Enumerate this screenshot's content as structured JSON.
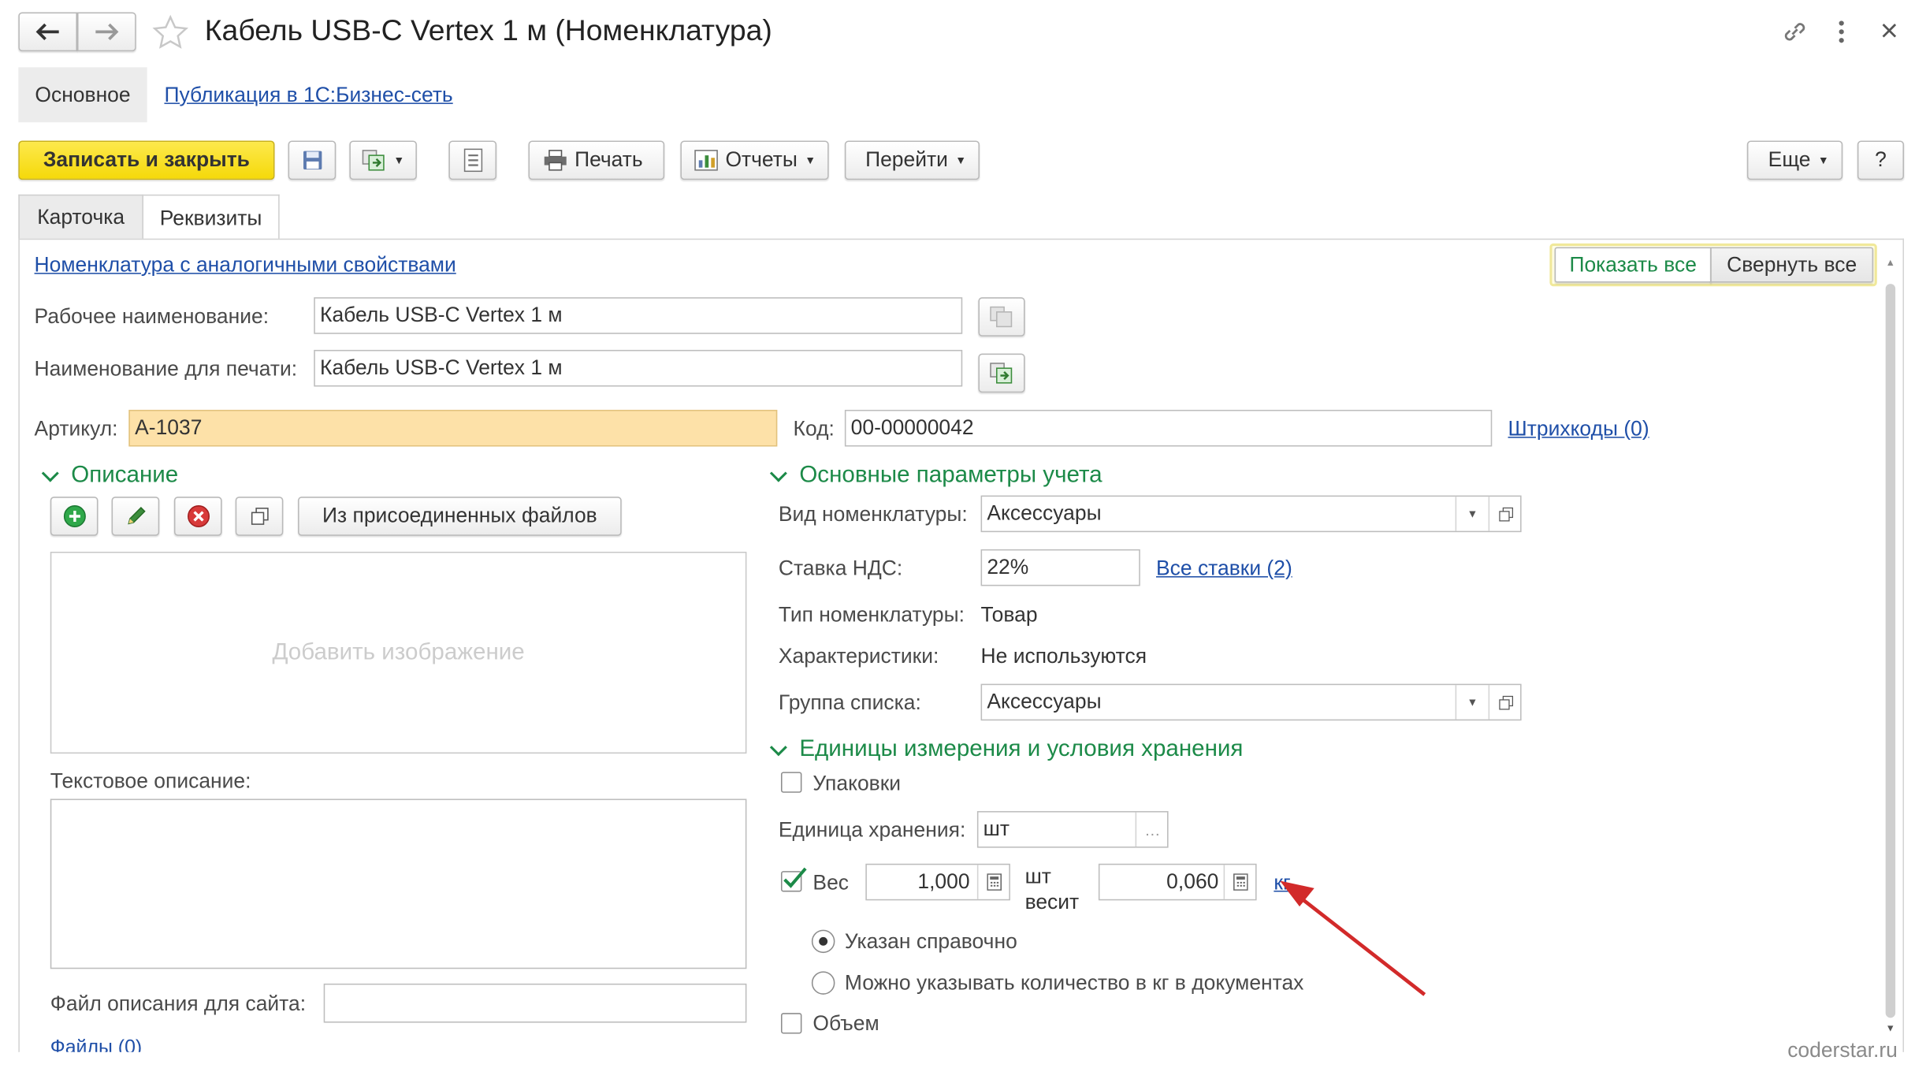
{
  "window": {
    "title": "Кабель USB-C Vertex 1 м (Номенклатура)"
  },
  "nav": {
    "main_label": "Основное",
    "publication_link": "Публикация в 1С:Бизнес-сеть"
  },
  "toolbar": {
    "save_close": "Записать и закрыть",
    "print": "Печать",
    "reports": "Отчеты",
    "goto": "Перейти",
    "more": "Еще",
    "help": "?"
  },
  "tabs": [
    {
      "label": "Карточка",
      "active": false
    },
    {
      "label": "Реквизиты",
      "active": true
    }
  ],
  "top": {
    "similar_link": "Номенклатура с аналогичными свойствами",
    "show_all": "Показать все",
    "collapse_all": "Свернуть все"
  },
  "fields": {
    "work_name_label": "Рабочее наименование:",
    "work_name_value": "Кабель USB-C Vertex 1 м",
    "print_name_label": "Наименование для печати:",
    "print_name_value": "Кабель USB-C Vertex 1 м",
    "article_label": "Артикул:",
    "article_value": "А-1037",
    "code_label": "Код:",
    "code_value": "00-00000042",
    "barcodes_link": "Штрихкоды (0)"
  },
  "description": {
    "header": "Описание",
    "from_files": "Из присоединенных файлов",
    "add_image": "Добавить изображение",
    "text_label": "Текстовое описание:",
    "site_file_label": "Файл описания для сайта:",
    "site_file_value": "",
    "files_link": "Файлы (0)"
  },
  "accounting": {
    "header": "Основные параметры учета",
    "kind_label": "Вид номенклатуры:",
    "kind_value": "Аксессуары",
    "vat_label": "Ставка НДС:",
    "vat_value": "22%",
    "all_rates_link": "Все ставки (2)",
    "type_label": "Тип номенклатуры:",
    "type_value": "Товар",
    "char_label": "Характеристики:",
    "char_value": "Не используются",
    "group_label": "Группа списка:",
    "group_value": "Аксессуары"
  },
  "units": {
    "header": "Единицы измерения и условия хранения",
    "packages_label": "Упаковки",
    "packages_checked": false,
    "storage_label": "Единица хранения:",
    "storage_value": "шт",
    "weight_label": "Вес",
    "weight_checked": true,
    "weight_qty": "1,000",
    "unit_pcs": "шт",
    "weighs": "весит",
    "weight_value": "0,060",
    "weight_unit": "кг",
    "radio_ref": "Указан справочно",
    "radio_ref_selected": true,
    "radio_kg": "Можно указывать количество в кг в документах",
    "volume_label": "Объем",
    "volume_checked": false
  },
  "watermark": "coderstar.ru",
  "colors": {
    "accent_yellow": "#fbe22f",
    "section_green": "#1c8a48",
    "link_blue": "#1f4fa8",
    "article_bg": "#fde1a8",
    "annotation_arrow": "#d22a2a"
  }
}
